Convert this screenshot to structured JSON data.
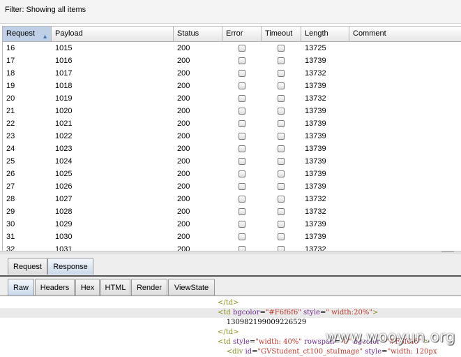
{
  "filter": {
    "label": "Filter:  Showing all items"
  },
  "table": {
    "columns": [
      "Request",
      "Payload",
      "Status",
      "Error",
      "Timeout",
      "Length",
      "Comment"
    ],
    "sorted_column": "Request",
    "rows": [
      {
        "request": "16",
        "payload": "1015",
        "status": "200",
        "error": false,
        "timeout": false,
        "length": "13725",
        "comment": ""
      },
      {
        "request": "17",
        "payload": "1016",
        "status": "200",
        "error": false,
        "timeout": false,
        "length": "13739",
        "comment": ""
      },
      {
        "request": "18",
        "payload": "1017",
        "status": "200",
        "error": false,
        "timeout": false,
        "length": "13732",
        "comment": ""
      },
      {
        "request": "19",
        "payload": "1018",
        "status": "200",
        "error": false,
        "timeout": false,
        "length": "13739",
        "comment": ""
      },
      {
        "request": "20",
        "payload": "1019",
        "status": "200",
        "error": false,
        "timeout": false,
        "length": "13732",
        "comment": ""
      },
      {
        "request": "21",
        "payload": "1020",
        "status": "200",
        "error": false,
        "timeout": false,
        "length": "13739",
        "comment": ""
      },
      {
        "request": "22",
        "payload": "1021",
        "status": "200",
        "error": false,
        "timeout": false,
        "length": "13739",
        "comment": ""
      },
      {
        "request": "23",
        "payload": "1022",
        "status": "200",
        "error": false,
        "timeout": false,
        "length": "13739",
        "comment": ""
      },
      {
        "request": "24",
        "payload": "1023",
        "status": "200",
        "error": false,
        "timeout": false,
        "length": "13739",
        "comment": ""
      },
      {
        "request": "25",
        "payload": "1024",
        "status": "200",
        "error": false,
        "timeout": false,
        "length": "13739",
        "comment": ""
      },
      {
        "request": "26",
        "payload": "1025",
        "status": "200",
        "error": false,
        "timeout": false,
        "length": "13739",
        "comment": ""
      },
      {
        "request": "27",
        "payload": "1026",
        "status": "200",
        "error": false,
        "timeout": false,
        "length": "13739",
        "comment": ""
      },
      {
        "request": "28",
        "payload": "1027",
        "status": "200",
        "error": false,
        "timeout": false,
        "length": "13732",
        "comment": ""
      },
      {
        "request": "29",
        "payload": "1028",
        "status": "200",
        "error": false,
        "timeout": false,
        "length": "13732",
        "comment": ""
      },
      {
        "request": "30",
        "payload": "1029",
        "status": "200",
        "error": false,
        "timeout": false,
        "length": "13739",
        "comment": ""
      },
      {
        "request": "31",
        "payload": "1030",
        "status": "200",
        "error": false,
        "timeout": false,
        "length": "13739",
        "comment": ""
      },
      {
        "request": "32",
        "payload": "1031",
        "status": "200",
        "error": false,
        "timeout": false,
        "length": "13732",
        "comment": ""
      }
    ]
  },
  "tabs_top": {
    "items": [
      "Request",
      "Response"
    ],
    "active": "Response"
  },
  "tabs_view": {
    "items": [
      "Raw",
      "Headers",
      "Hex",
      "HTML",
      "Render",
      "ViewState"
    ],
    "active": "Raw"
  },
  "response_code": {
    "lines": [
      {
        "text": "</td>",
        "highlight": false
      },
      {
        "text": "<td bgcolor=\"#F6f6f6\" style=\" width:20%\">",
        "highlight": true
      },
      {
        "text": "    130982199009226529",
        "highlight": false
      },
      {
        "text": "</td>",
        "highlight": false
      },
      {
        "text": "<td style=\"width: 40%\" rowspan=\"8\" bgcolor=\"#F6f6f6\" >",
        "highlight": false
      },
      {
        "text": "    <div id=\"GVStudent_ct100_stuImage\" style=\"width: 120px",
        "highlight": false
      }
    ]
  },
  "watermark": "www.wooyun.org",
  "colors": {
    "tag": "#8a8f22",
    "attr": "#6c2b8e",
    "value": "#b53a2f",
    "sorted_header": "#bfcfe6"
  }
}
